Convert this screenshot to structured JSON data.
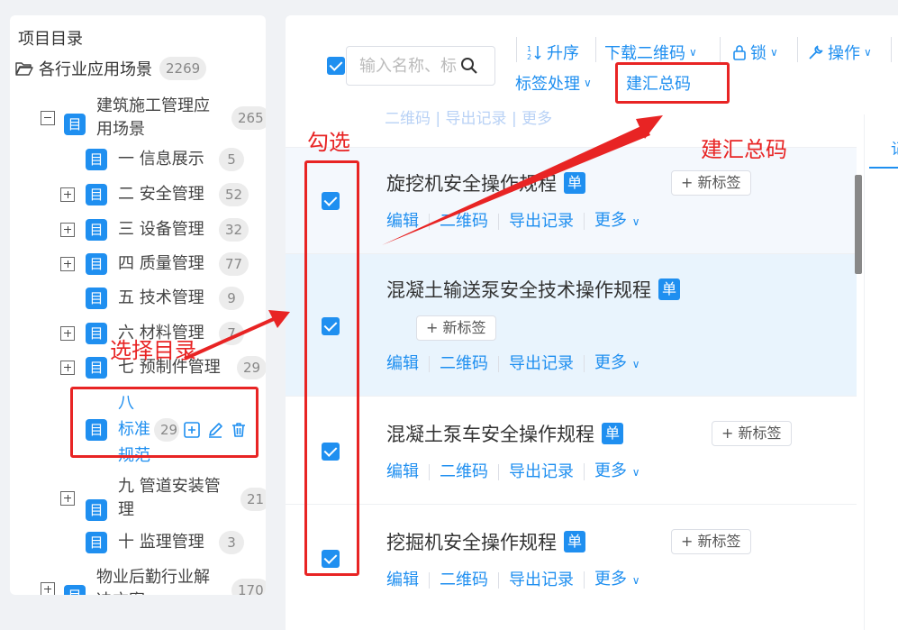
{
  "sidebar": {
    "title": "项目目录",
    "root": {
      "label": "各行业应用场景",
      "count": "2269"
    },
    "nodes": [
      {
        "label": "建筑施工管理应用场景",
        "count": "265"
      },
      {
        "label": "一 信息展示",
        "count": "5"
      },
      {
        "label": "二 安全管理",
        "count": "52"
      },
      {
        "label": "三 设备管理",
        "count": "32"
      },
      {
        "label": "四 质量管理",
        "count": "77"
      },
      {
        "label": "五 技术管理",
        "count": "9"
      },
      {
        "label": "六 材料管理",
        "count": "7"
      },
      {
        "label": "七 预制件管理",
        "count": "29"
      },
      {
        "label": "八 标准规范",
        "count": "29"
      },
      {
        "label": "九 管道安装管理",
        "count": "21"
      },
      {
        "label": "十 监理管理",
        "count": "3"
      },
      {
        "label": "物业后勤行业解决方案",
        "count": "170"
      }
    ],
    "icon_char": "目"
  },
  "toolbar": {
    "search_placeholder": "输入名称、标",
    "sort": "升序",
    "download_qr": "下载二维码",
    "lock": "锁",
    "operate": "操作",
    "tag_process": "标签处理",
    "build_summary": "建汇总码"
  },
  "ghost_row": "二维码 | 导出记录 | 更多",
  "rows": [
    {
      "title": "旋挖机安全操作规程",
      "badge": "单",
      "tag": "+ 新标签"
    },
    {
      "title": "混凝土输送泵安全技术操作规程",
      "badge": "单",
      "tag": "+ 新标签"
    },
    {
      "title": "混凝土泵车安全操作规程",
      "badge": "单",
      "tag": "+ 新标签"
    },
    {
      "title": "挖掘机安全操作规程",
      "badge": "单",
      "tag": "+ 新标签"
    }
  ],
  "row_actions": {
    "edit": "编辑",
    "qr": "二维码",
    "export": "导出记录",
    "more": "更多"
  },
  "right_tab_char": "记",
  "annotations": {
    "check": "勾选",
    "select_dir": "选择目录",
    "build_summary": "建汇总码"
  },
  "colors": {
    "accent": "#1f8ff0",
    "annotation": "#e82424"
  }
}
